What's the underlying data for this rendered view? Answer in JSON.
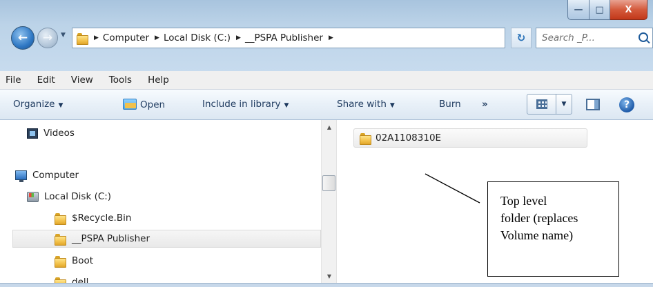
{
  "window": {
    "controls": {
      "minimize": "—",
      "maximize": "□",
      "close": "X"
    }
  },
  "address": {
    "crumbs": [
      "Computer",
      "Local Disk (C:)",
      "__PSPA Publisher"
    ],
    "search_placeholder": "Search _P..."
  },
  "menu": [
    "File",
    "Edit",
    "View",
    "Tools",
    "Help"
  ],
  "toolbar": {
    "organize": "Organize",
    "open": "Open",
    "include": "Include in library",
    "share": "Share with",
    "burn": "Burn",
    "more": "»",
    "help": "?"
  },
  "nav": {
    "items": [
      {
        "label": "Videos",
        "icon": "video-icon"
      },
      {
        "label": "Computer",
        "icon": "computer-icon"
      },
      {
        "label": "Local Disk (C:)",
        "icon": "disk-icon"
      },
      {
        "label": "$Recycle.Bin",
        "icon": "folder-icon"
      },
      {
        "label": "__PSPA Publisher",
        "icon": "folder-icon",
        "selected": true
      },
      {
        "label": "Boot",
        "icon": "folder-icon"
      },
      {
        "label": "dell",
        "icon": "folder-icon"
      }
    ]
  },
  "content": {
    "folder": "02A1108310E"
  },
  "callout": {
    "lines": [
      "Top level",
      "folder (replaces",
      "Volume name)"
    ]
  },
  "colors": {
    "chrome": "#bcd3e8",
    "close_button": "#d45a3c",
    "selection": "#e9e9e9"
  }
}
